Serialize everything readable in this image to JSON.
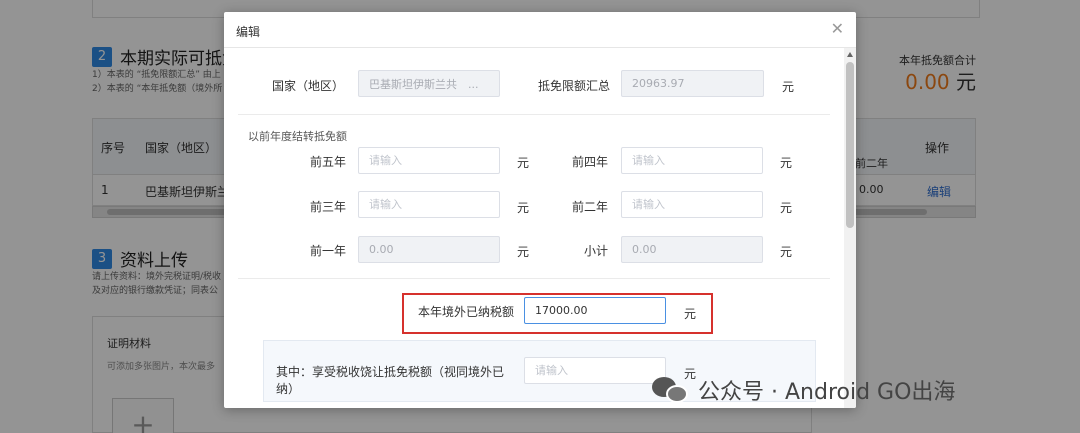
{
  "background": {
    "section2_num": "2",
    "section2_title": "本期实际可抵免",
    "note_line1": "1）本表的 “抵免限额汇总” 由上",
    "note_line2": "2）本表的 “本年抵免额（境外所",
    "right_label": "本年抵免额合计",
    "right_total": "0.00",
    "right_unit": "元",
    "table": {
      "headers": [
        "序号",
        "国家（地区）",
        "前二年",
        "操作"
      ],
      "row": [
        "1",
        "巴基斯坦伊斯兰",
        "0.00",
        "编辑"
      ]
    },
    "section3_num": "3",
    "section3_title": "资料上传",
    "upload_note1": "请上传资料：境外完税证明/税收",
    "upload_note2": "及对应的银行缴款凭证；同表公",
    "upload_title": "证明材料",
    "upload_hint": "可添加多张图片，本次最多",
    "plus": "+"
  },
  "modal": {
    "title": "编辑",
    "close_icon": "close-icon",
    "country_label": "国家（地区）",
    "country_value": "巴基斯坦伊斯兰共　...",
    "limit_label": "抵免限额汇总",
    "limit_value": "20963.97",
    "unit": "元",
    "group_title": "以前年度结转抵免额",
    "y5_label": "前五年",
    "y4_label": "前四年",
    "y3_label": "前三年",
    "y2_label": "前二年",
    "y1_label": "前一年",
    "subtotal_label": "小计",
    "placeholder": "请输入",
    "y1_value": "0.00",
    "subtotal_value": "0.00",
    "paid_label": "本年境外已纳税额",
    "paid_value": "17000.00",
    "sub_label": "其中：享受税收饶让抵免税额（视同境外已纳）"
  },
  "watermark": {
    "text": "公众号 · Android GO出海",
    "icon": "wechat-icon"
  }
}
